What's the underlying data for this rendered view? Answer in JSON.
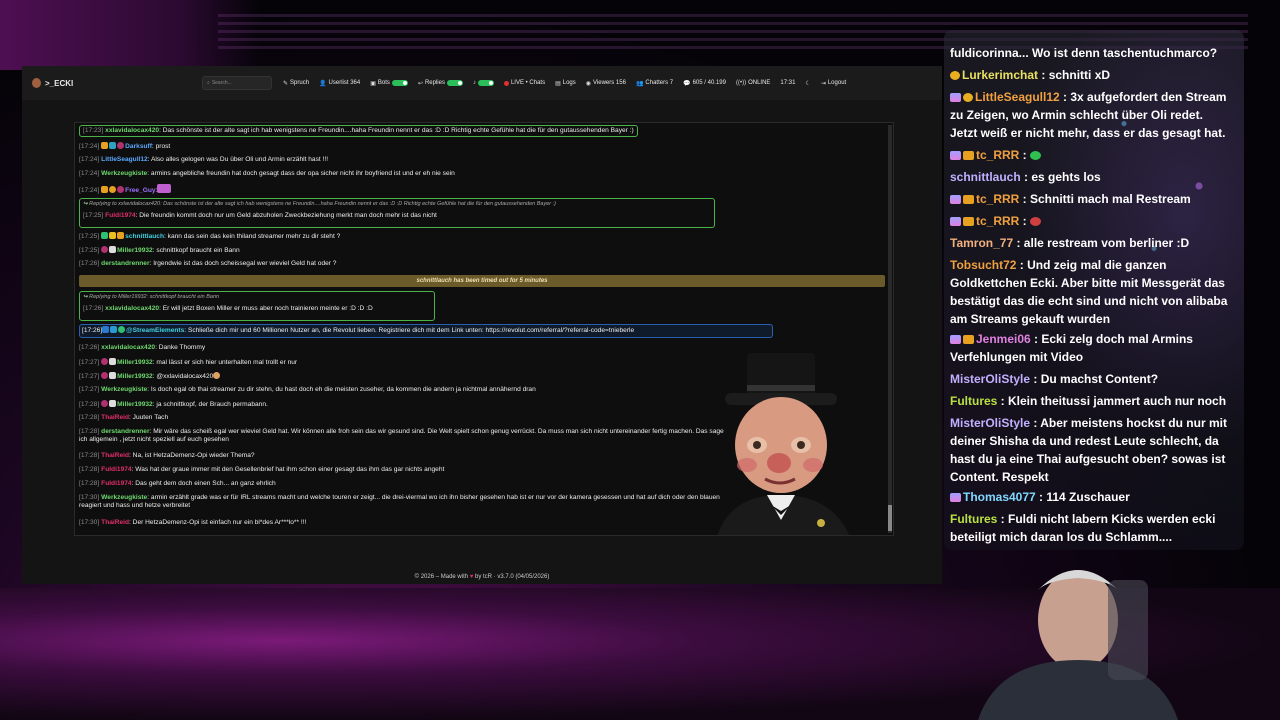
{
  "app": {
    "brand": ">_ECKI"
  },
  "nav": {
    "search_placeholder": "Search...",
    "items": [
      {
        "label": "Spruch"
      },
      {
        "label": "Userlist 364"
      },
      {
        "label": "Bots"
      },
      {
        "label": "Replies"
      },
      {
        "label": "LIVE • Chats"
      },
      {
        "label": "Logs"
      },
      {
        "label": "Viewers 156"
      },
      {
        "label": "Chatters 7"
      },
      {
        "label": "605 / 40.199"
      },
      {
        "label": "ONLINE"
      },
      {
        "label": "17:31"
      },
      {
        "label": "Logout"
      }
    ]
  },
  "chat": {
    "messages": [
      {
        "ts": "[17:23]",
        "user": "xxlavidalocax420",
        "text": ": Das schönste ist der alte sagt ich hab wenigstens ne Freundin....haha Freundin nennt er das :D :D Richtig echte Gefühle hat die für den gutaussehenden Bayer :)"
      },
      {
        "ts": "[17:24]",
        "user": "Darksuff",
        "text": ": prost"
      },
      {
        "ts": "[17:24]",
        "user": "LittleSeagull12",
        "text": ": Also alles gelogen was Du über Oli und Armin erzählt hast !!!"
      },
      {
        "ts": "[17:24]",
        "user": "Werkzeugkiste",
        "text": ": armins angebliche freundin hat doch gesagt dass der opa sicher nicht ihr boyfriend ist und er eh nie sein"
      },
      {
        "ts": "[17:24]",
        "user": "Free_Guy",
        "text": ":"
      },
      {
        "reply": "Replying to xxlavidalocax420: Das schönste ist der alte sagt ich hab wenigstens ne Freundin....haha Freundin nennt er das :D :D Richtig echte Gefühle hat die für den gutaussehenden Bayer :)",
        "ts": "[17:25]",
        "user": "Fuldi1974",
        "text": ": Die freundin kommt doch nur um Geld abzuholen Zweckbeziehung merkt man doch mehr ist das nicht"
      },
      {
        "ts": "[17:25]",
        "user": "schnittlauch",
        "text": ": kann das sein das kein thiland streamer mehr zu dir steht ?"
      },
      {
        "ts": "[17:25]",
        "user": "Miller19932",
        "text": ": schnittkopf braucht ein Bann"
      },
      {
        "ts": "[17:26]",
        "user": "derstandrenner",
        "text": ": Irgendwie ist das doch scheissegal wer wieviel Geld hat oder ?"
      },
      {
        "timeout": "schnittlauch has been timed out for 5 minutes"
      },
      {
        "reply": "Replying to Miller19932: schnittkopf braucht ein Bann",
        "ts": "[17:26]",
        "user": "xxlavidalocax420",
        "text": ": Er will jetzt Boxen Miller er muss aber noch trainieren meinte er :D :D :D"
      },
      {
        "ts": "[17:26]",
        "user": "@StreamElements",
        "text": ": Schließe dich mir und 60 Millionen Nutzer an, die Revolut lieben. Registriere dich mit dem Link unten: https://revolut.com/referral/?referral-code=tnieberle"
      },
      {
        "ts": "[17:26]",
        "user": "xxlavidalocax420",
        "text": ": Danke Thommy"
      },
      {
        "ts": "[17:27]",
        "user": "Miller19932",
        "text": ": mal lässt er sich hier unterhalten mal trollt er nur"
      },
      {
        "ts": "[17:27]",
        "user": "Miller19932",
        "text": ": @xxlavidalocax420"
      },
      {
        "ts": "[17:27]",
        "user": "Werkzeugkiste",
        "text": ": Is doch egal ob thai streamer zu dir stehn, du hast doch eh die meisten zuseher, da kommen die andern ja nichtmal annähernd dran"
      },
      {
        "ts": "[17:28]",
        "user": "Miller19932",
        "text": ": ja schnittkopf, der Brauch permabann."
      },
      {
        "ts": "[17:28]",
        "user": "ThaiReid",
        "text": ": Juuten Tach"
      },
      {
        "ts": "[17:28]",
        "user": "derstandrenner",
        "text": ": Mir wäre das scheiß egal wer wieviel Geld hat. Wir können alle froh sein das wir gesund sind. Die Welt spielt schon genug verrückt. Da muss man sich nicht untereinander fertig machen. Das sage",
        "cont": "ich allgemein , jetzt nicht speziell auf euch gesehen"
      },
      {
        "ts": "[17:28]",
        "user": "ThaiReid",
        "text": ": Na, ist HetzaDemenz-Opi wieder Thema?"
      },
      {
        "ts": "[17:28]",
        "user": "Fuldi1974",
        "text": ": Was hat der graue immer mit den Gesellenbrief hat ihm schon einer gesagt das ihm das gar nichts angeht"
      },
      {
        "ts": "[17:28]",
        "user": "Fuldi1974",
        "text": ": Das geht dem doch einen Sch... an ganz ehrlich"
      },
      {
        "ts": "[17:30]",
        "user": "Werkzeugkiste",
        "text": ": armin erzählt grade was er für IRL streams macht und welche touren er zeigt... die drei-viermal wo ich ihn bisher gesehen hab ist er nur vor der kamera gesessen und hat auf dich oder den blauen",
        "cont": "reagiert und hass und hetze verbreitet"
      },
      {
        "ts": "[17:30]",
        "user": "ThaiReid",
        "text": ": Der HetzaDemenz-Opi ist einfach nur ein bl*des Ar***lo** !!!"
      }
    ]
  },
  "footer": {
    "pre": "© 2026 – Made with",
    "post": "by tcR · v3.7.0 (04/05/2026)"
  },
  "overlay": {
    "messages": [
      {
        "user": "",
        "text": "fuldicorinna... Wo ist denn taschentuchmarco?"
      },
      {
        "user": "Lurkerimchat",
        "text": " : schnitti xD"
      },
      {
        "user": "LittleSeagull12",
        "text": " : 3x aufgefordert den Stream zu Zeigen, wo Armin schlecht über Oli redet. Jetzt weiß er nicht mehr, dass er das gesagt hat."
      },
      {
        "user": "tc_RRR",
        "text": " :"
      },
      {
        "user": "schnittlauch",
        "text": " : es gehts los"
      },
      {
        "user": "tc_RRR",
        "text": " : Schnitti mach mal Restream"
      },
      {
        "user": "tc_RRR",
        "text": " :"
      },
      {
        "user": "Tamron_77",
        "text": " : alle restream vom berliner :D"
      },
      {
        "user": "Tobsucht72",
        "text": " : Und zeig mal die ganzen Goldkettchen Ecki. Aber bitte mit Messgerät das bestätigt das die echt sind und nicht von alibaba am Streams gekauft wurden"
      },
      {
        "user": "Jenmei06",
        "text": " : Ecki zelg doch mal Armins Verfehlungen mit Video"
      },
      {
        "user": "MisterOliStyle",
        "text": " : Du machst Content?"
      },
      {
        "user": "Fultures",
        "text": " : Klein theitussi jammert auch nur noch"
      },
      {
        "user": "MisterOliStyle",
        "text": " : Aber meistens hockst du nur mit deiner Shisha da und redest Leute schlecht, da hast du ja eine Thai aufgesucht oben? sowas ist Content. Respekt"
      },
      {
        "user": "Thomas4077",
        "text": " : 114 Zuschauer"
      },
      {
        "user": "Fultures",
        "text": " : Fuldi nicht labern Kicks werden ecki beteiligt mich daran los du Schlamm...."
      }
    ]
  },
  "colors": {
    "accent_green": "#2bbf5a",
    "live_red": "#e23030",
    "timeout_bg": "#6b5a2a"
  }
}
